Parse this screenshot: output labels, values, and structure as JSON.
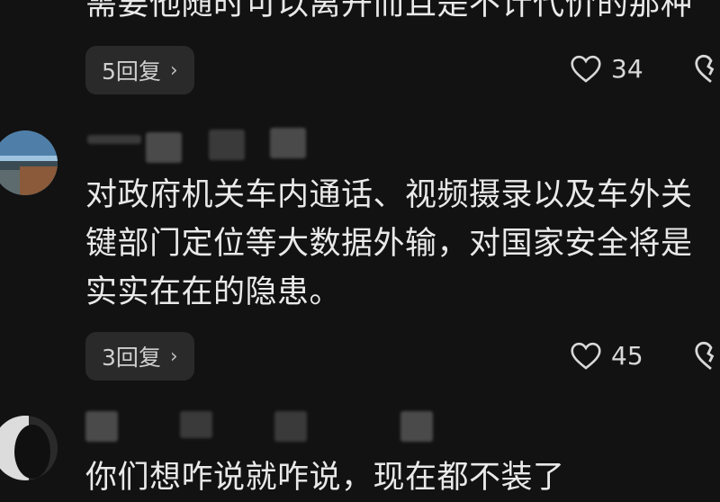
{
  "comments": [
    {
      "text_lines": [
        "需要他随时可以离开而且是不计代价的那种"
      ],
      "replies_label": "5回复",
      "likes": "34"
    },
    {
      "text_lines": [
        "对政府机关车内通话、视频摄录以及车外关",
        "键部门定位等大数据外输，对国家安全将是",
        "实实在在的隐患。"
      ],
      "replies_label": "3回复",
      "likes": "45"
    },
    {
      "text_lines": [
        "你们想咋说就咋说，现在都不装了"
      ]
    }
  ],
  "icons": {
    "chevron": "chevron-right-icon",
    "like": "heart-icon",
    "dislike": "broken-heart-icon"
  },
  "colors": {
    "background": "#121212",
    "reply_button_bg": "#2a2a2a",
    "text": "#e9e9e9"
  }
}
